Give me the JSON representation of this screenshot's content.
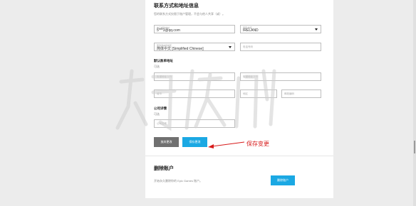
{
  "contact": {
    "title": "联系方式和地址信息",
    "subtitle": "您的联系方式仅限于账户管理，不会与他人共享（或）。",
    "email": {
      "label": "电子邮件地址",
      "value": "5***3@qq.com"
    },
    "country": {
      "label": "国家/地区",
      "value": "IRELAND"
    },
    "language": {
      "label": "首选语言和地区",
      "value": "简体中文 [Simplified Chinese]"
    },
    "phone": {
      "placeholder": "电话号码"
    }
  },
  "address": {
    "title": "默认账单地址",
    "subtitle": "可选",
    "line1_placeholder": "街道地址 1 行",
    "line2_placeholder": "街道地址 2 行",
    "city_placeholder": "城市",
    "region_placeholder": "地区",
    "postal_placeholder": "邮政编码"
  },
  "company": {
    "title": "公司详情",
    "subtitle": "可选",
    "name_placeholder": "公司名称"
  },
  "actions": {
    "cancel_label": "放弃更改",
    "save_label": "保存更改"
  },
  "delete": {
    "title": "删除账户",
    "subtitle": "开始永久删除你的 Epic Games 账户。",
    "button_label": "删除账户"
  },
  "annotation": {
    "text": "保存变更",
    "color": "#d71a1a"
  },
  "colors": {
    "accent": "#1ba8e3",
    "cancel": "#707070"
  }
}
